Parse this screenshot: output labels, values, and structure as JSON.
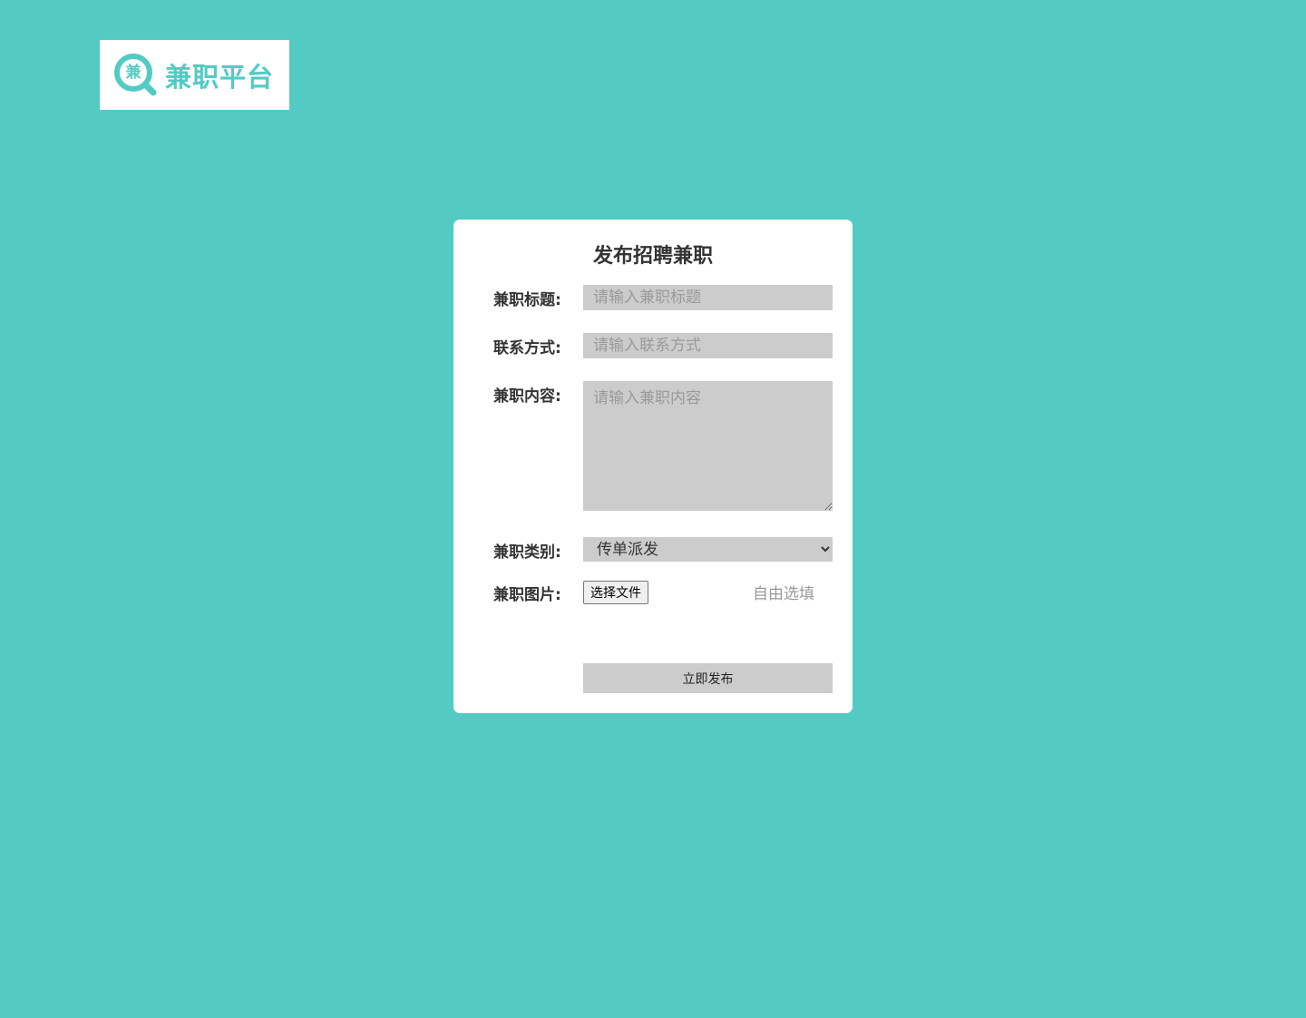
{
  "colors": {
    "background": "#53cbc4",
    "card": "#ffffff",
    "field": "#cccccc",
    "brand": "#53cbc4",
    "text": "#333333",
    "placeholder": "#9a9a9a"
  },
  "logo": {
    "mark_char": "兼",
    "title": "兼职平台",
    "icon": "magnifier-icon"
  },
  "form": {
    "title": "发布招聘兼职",
    "fields": {
      "job_title": {
        "label": "兼职标题:",
        "placeholder": "请输入兼职标题",
        "value": ""
      },
      "contact": {
        "label": "联系方式:",
        "placeholder": "请输入联系方式",
        "value": ""
      },
      "content": {
        "label": "兼职内容:",
        "placeholder": "请输入兼职内容",
        "value": ""
      },
      "category": {
        "label": "兼职类别:",
        "selected": "传单派发"
      },
      "image": {
        "label": "兼职图片:",
        "button_label": "选择文件",
        "hint": "自由选填"
      }
    },
    "submit_label": "立即发布"
  }
}
